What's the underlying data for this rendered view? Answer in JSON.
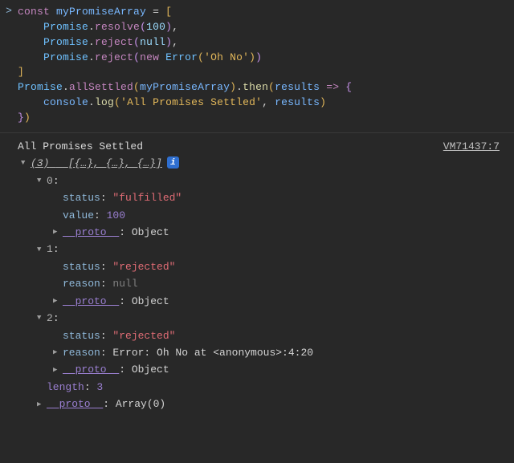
{
  "input": {
    "prompt_mark": ">",
    "code_lines": [
      "const myPromiseArray = [",
      "    Promise.resolve(100),",
      "    Promise.reject(null),",
      "    Promise.reject(new Error('Oh No'))",
      "]",
      "Promise.allSettled(myPromiseArray).then(results => {",
      "    console.log('All Promises Settled', results)",
      "})"
    ]
  },
  "output": {
    "log_title": "All Promises Settled",
    "source_link": "VM71437:7",
    "summary_count": "(3)",
    "summary_body": "[{…}, {…}, {…}]",
    "info_badge": "i",
    "items": [
      {
        "index": "0",
        "props": [
          {
            "key": "status",
            "val": "\"fulfilled\"",
            "kind": "str"
          },
          {
            "key": "value",
            "val": "100",
            "kind": "num"
          }
        ],
        "proto_label": "__proto__",
        "proto_val": "Object"
      },
      {
        "index": "1",
        "props": [
          {
            "key": "status",
            "val": "\"rejected\"",
            "kind": "str"
          },
          {
            "key": "reason",
            "val": "null",
            "kind": "null"
          }
        ],
        "proto_label": "__proto__",
        "proto_val": "Object"
      },
      {
        "index": "2",
        "props": [
          {
            "key": "status",
            "val": "\"rejected\"",
            "kind": "str"
          },
          {
            "key": "reason",
            "val": "Error: Oh No at <anonymous>:4:20",
            "kind": "obj",
            "expandable": true
          }
        ],
        "proto_label": "__proto__",
        "proto_val": "Object"
      }
    ],
    "length_label": "length",
    "length_val": "3",
    "array_proto_label": "__proto__",
    "array_proto_val": "Array(0)"
  }
}
